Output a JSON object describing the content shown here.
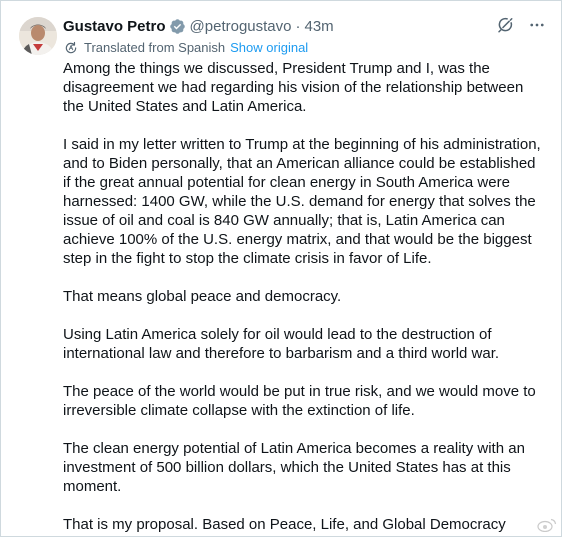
{
  "post": {
    "author_name": "Gustavo Petro",
    "handle": "@petrogustavo",
    "separator": "·",
    "time": "43m",
    "translated_label": "Translated from Spanish",
    "show_original": "Show original",
    "paragraphs": [
      "Among the things we discussed, President Trump and I, was the disagreement we had regarding his vision of the relationship between the United States and Latin America.",
      "I said in my letter written to Trump at the beginning of his administration, and to Biden personally, that an American alliance could be established if the great annual potential for clean energy in South America were harnessed: 1400 GW, while the U.S. demand for energy that solves the issue of oil and coal is 840 GW annually; that is, Latin America can achieve 100% of the U.S. energy matrix, and that would be the biggest step in the fight to stop the climate crisis in favor of Life.",
      "That means global peace and democracy.",
      "Using Latin America solely for oil would lead to the destruction of international law and therefore to barbarism and a third world war.",
      "The peace of the world would be put in true risk, and we would move to irreversible climate collapse with the extinction of life.",
      "The clean energy potential of Latin America becomes a reality with an investment of 500 billion dollars, which the United States has at this moment.",
      "That is my proposal. Based on Peace, Life, and Global Democracy"
    ]
  },
  "icons": {
    "verified": "verified-badge-icon",
    "grok": "grok-icon",
    "more": "more-icon",
    "translate": "translate-icon",
    "watermark": "weibo-watermark-icon"
  },
  "colors": {
    "accent": "#1d9bf0",
    "text": "#0f1419",
    "muted": "#536471",
    "border": "#cfd9de"
  }
}
